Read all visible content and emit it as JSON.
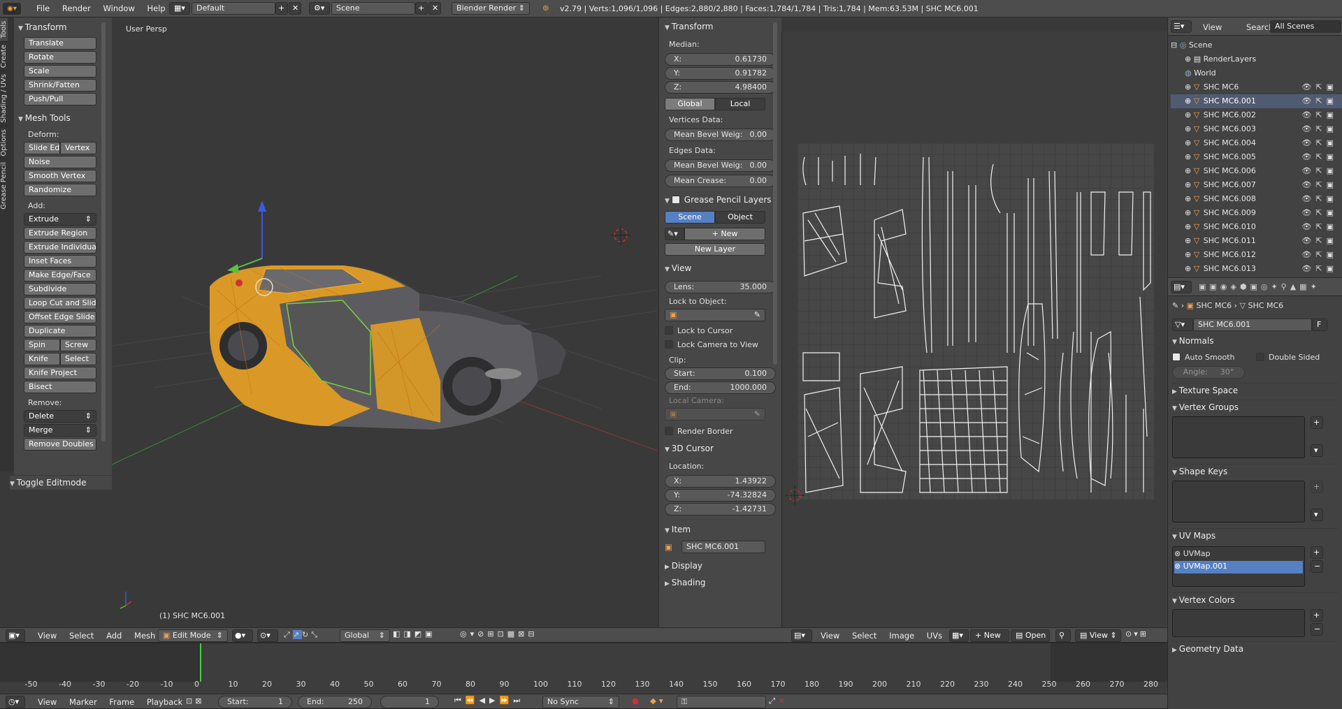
{
  "topbar": {
    "menus": [
      "File",
      "Render",
      "Window",
      "Help"
    ],
    "layout": "Default",
    "scene": "Scene",
    "engine": "Blender Render",
    "stats": "v2.79 | Verts:1,096/1,096 | Edges:2,880/2,880 | Faces:1,784/1,784 | Tris:1,784 | Mem:63.53M | SHC MC6.001"
  },
  "toolshelf": {
    "tabs": [
      "Tools",
      "Create",
      "Shading / UVs",
      "Options",
      "Grease Pencil"
    ],
    "transform_title": "Transform",
    "transform": [
      "Translate",
      "Rotate",
      "Scale",
      "Shrink/Fatten",
      "Push/Pull"
    ],
    "mesh_title": "Mesh Tools",
    "deform_label": "Deform:",
    "slide_edge": "Slide Ed",
    "vertex": "Vertex",
    "deform": [
      "Noise",
      "Smooth Vertex",
      "Randomize"
    ],
    "add_label": "Add:",
    "extrude": "Extrude",
    "add": [
      "Extrude Region",
      "Extrude Individual",
      "Inset Faces",
      "Make Edge/Face",
      "Subdivide",
      "Loop Cut and Slide",
      "Offset Edge Slide",
      "Duplicate"
    ],
    "spin": "Spin",
    "screw": "Screw",
    "knife": "Knife",
    "select": "Select",
    "knife_project": "Knife Project",
    "bisect": "Bisect",
    "remove_label": "Remove:",
    "delete": "Delete",
    "merge": "Merge",
    "remove_doubles": "Remove Doubles",
    "toggle_editmode": "Toggle Editmode"
  },
  "viewport": {
    "label": "User Persp",
    "object": "(1) SHC MC6.001"
  },
  "props": {
    "transform_title": "Transform",
    "median": "Median:",
    "x_label": "X:",
    "x": "0.61730",
    "y_label": "Y:",
    "y": "0.91782",
    "z_label": "Z:",
    "z": "4.98400",
    "global": "Global",
    "local": "Local",
    "vertices_data": "Vertices Data:",
    "mean_bevel_label": "Mean Bevel Weig:",
    "mean_bevel_v": "0.00",
    "edges_data": "Edges Data:",
    "mean_bevel_e": "0.00",
    "mean_crease_label": "Mean Crease:",
    "mean_crease": "0.00",
    "gp_title": "Grease Pencil Layers",
    "gp_scene": "Scene",
    "gp_object": "Object",
    "gp_new": "New",
    "gp_new_layer": "New Layer",
    "view_title": "View",
    "lens_label": "Lens:",
    "lens": "35.000",
    "lock_obj": "Lock to Object:",
    "lock_cursor": "Lock to Cursor",
    "lock_cam": "Lock Camera to View",
    "clip": "Clip:",
    "start_label": "Start:",
    "start": "0.100",
    "end_label": "End:",
    "end": "1000.000",
    "local_camera": "Local Camera:",
    "render_border": "Render Border",
    "cursor_title": "3D Cursor",
    "location": "Location:",
    "cx": "1.43922",
    "cy": "-74.32824",
    "cz": "-1.42731",
    "item_title": "Item",
    "item_name": "SHC MC6.001",
    "display": "Display",
    "shading": "Shading"
  },
  "viewport_header": {
    "menus": [
      "View",
      "Select",
      "Add",
      "Mesh"
    ],
    "mode": "Edit Mode",
    "orientation": "Global"
  },
  "uv_header": {
    "menus": [
      "View",
      "Select",
      "Image",
      "UVs"
    ],
    "new": "New",
    "open": "Open",
    "view": "View"
  },
  "outliner": {
    "view": "View",
    "search": "Search",
    "filter": "All Scenes",
    "scene": "Scene",
    "render_layers": "RenderLayers",
    "world": "World",
    "objects": [
      "SHC MC6",
      "SHC MC6.001",
      "SHC MC6.002",
      "SHC MC6.003",
      "SHC MC6.004",
      "SHC MC6.005",
      "SHC MC6.006",
      "SHC MC6.007",
      "SHC MC6.008",
      "SHC MC6.009",
      "SHC MC6.010",
      "SHC MC6.011",
      "SHC MC6.012",
      "SHC MC6.013"
    ]
  },
  "data_props": {
    "crumb1": "SHC MC6",
    "crumb2": "SHC MC6",
    "mesh_name": "SHC MC6.001",
    "fake_user": "F",
    "normals": "Normals",
    "auto_smooth": "Auto Smooth",
    "double_sided": "Double Sided",
    "angle_label": "Angle:",
    "angle": "30°",
    "texture_space": "Texture Space",
    "vertex_groups": "Vertex Groups",
    "shape_keys": "Shape Keys",
    "uv_maps": "UV Maps",
    "uv1": "UVMap",
    "uv2": "UVMap.001",
    "vertex_colors": "Vertex Colors",
    "geometry_data": "Geometry Data"
  },
  "timeline": {
    "menus": [
      "View",
      "Marker",
      "Frame",
      "Playback"
    ],
    "start_label": "Start:",
    "start": "1",
    "end_label": "End:",
    "end": "250",
    "current": "1",
    "sync": "No Sync",
    "ticks": [
      "-50",
      "-40",
      "-30",
      "-20",
      "-10",
      "0",
      "10",
      "20",
      "30",
      "40",
      "50",
      "60",
      "70",
      "80",
      "90",
      "100",
      "110",
      "120",
      "130",
      "140",
      "150",
      "160",
      "170",
      "180",
      "190",
      "200",
      "210",
      "220",
      "230",
      "240",
      "250",
      "260",
      "270",
      "280"
    ]
  },
  "colors": {
    "accent": "#5680c2",
    "mesh": "#f0a020",
    "bg": "#393939"
  }
}
